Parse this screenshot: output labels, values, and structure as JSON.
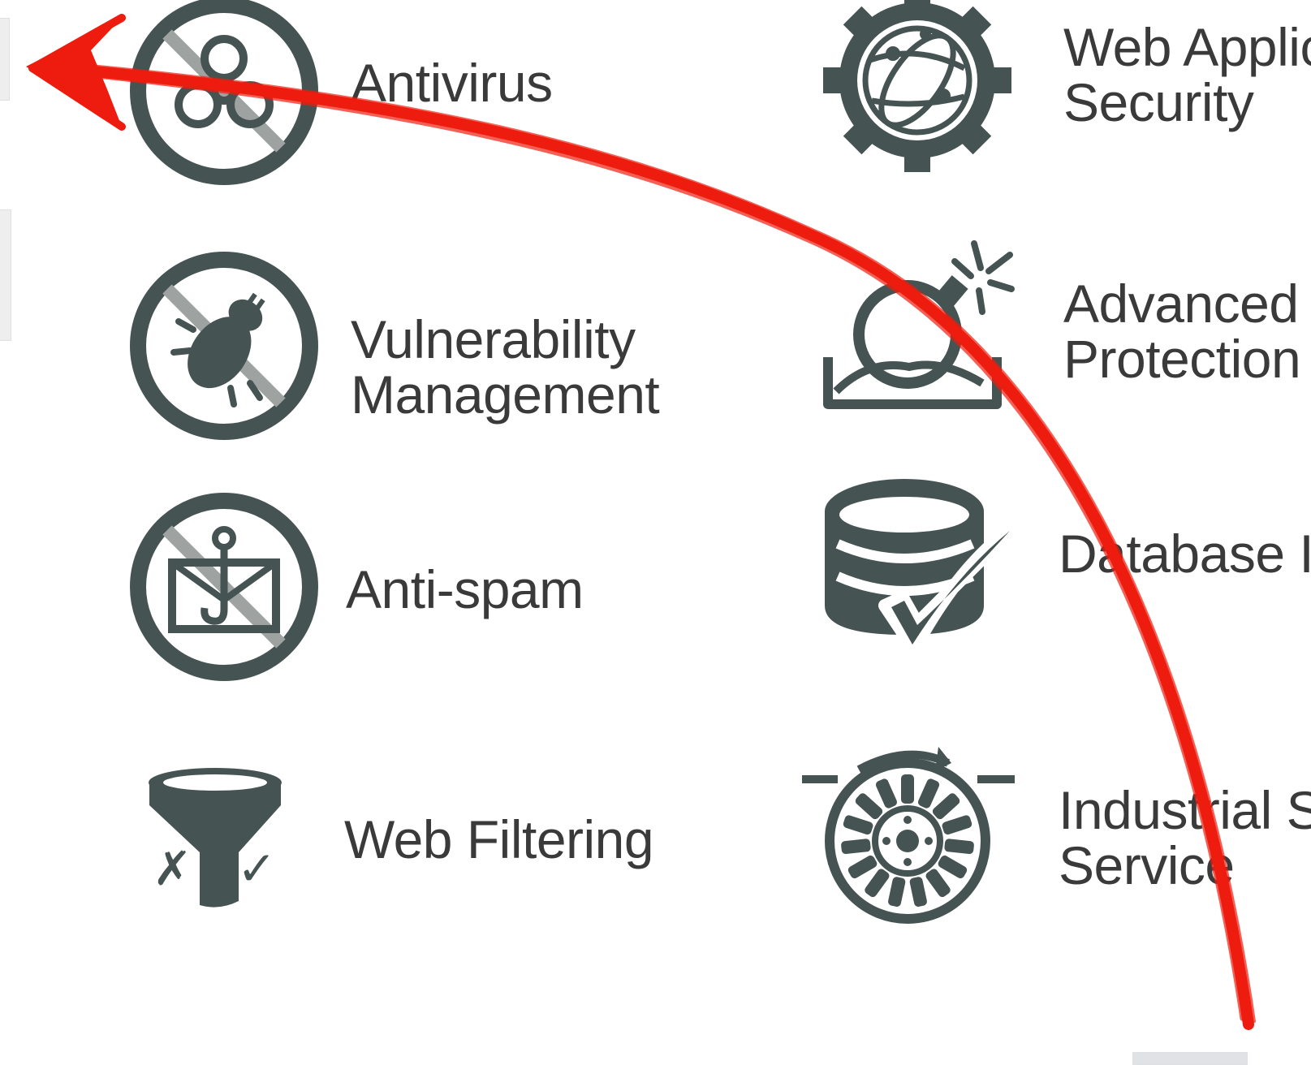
{
  "colors": {
    "icon": "#455352",
    "slash": "#9ea3a2",
    "text": "#3a3a3a",
    "arrow": "#ee1c0e"
  },
  "left_items": [
    {
      "icon": "biohazard-prohibited-icon",
      "line1": "Antivirus",
      "line2": ""
    },
    {
      "icon": "bug-prohibited-icon",
      "line1": "Vulnerability",
      "line2": "Management"
    },
    {
      "icon": "phishing-envelope-prohibited-icon",
      "line1": "Anti-spam",
      "line2": ""
    },
    {
      "icon": "funnel-filter-icon",
      "line1": "Web Filtering",
      "line2": ""
    }
  ],
  "right_items": [
    {
      "icon": "gear-globe-icon",
      "line1": "Web Applic",
      "line2": "Security"
    },
    {
      "icon": "bomb-sandbox-icon",
      "line1": "Advanced",
      "line2": "Protection"
    },
    {
      "icon": "database-check-icon",
      "line1": "Database I",
      "line2": ""
    },
    {
      "icon": "turbine-icon",
      "line1": "Industrial S",
      "line2": "Service"
    }
  ],
  "arrow": {
    "icon": "hand-drawn-curved-arrow-icon"
  }
}
